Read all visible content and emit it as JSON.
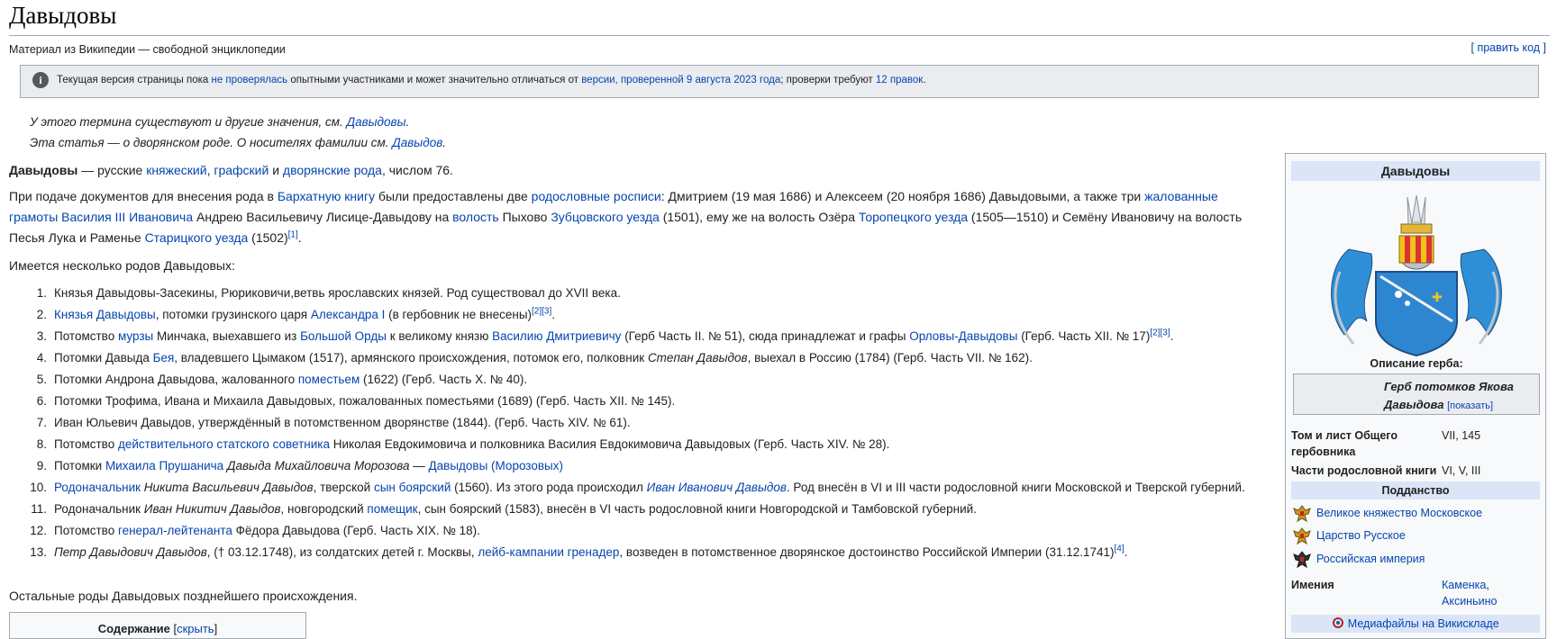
{
  "title": "Давыдовы",
  "tagline": "Материал из Википедии — свободной энциклопедии",
  "edit_link": "[ править код ]",
  "notice": {
    "t1": "Текущая версия страницы пока ",
    "l1": "не проверялась",
    "t2": " опытными участниками и может значительно отличаться от ",
    "l2": "версии, проверенной 9 августа 2023 года",
    "t3": "; проверки требуют ",
    "l3": "12 правок",
    "t4": "."
  },
  "hatnotes": {
    "h1_text": "У этого термина существуют и другие значения, см. ",
    "h1_link": "Давыдовы",
    "h1_end": ".",
    "h2_text": "Эта статья — о дворянском роде. О носителях фамилии см. ",
    "h2_link": "Давыдов",
    "h2_end": "."
  },
  "intro": {
    "bold": "Давыдовы",
    "t1": " — русские ",
    "l1": "княжеский",
    "t2": ", ",
    "l2": "графский",
    "t3": " и ",
    "l3": "дворянские рода",
    "t4": ", числом 76."
  },
  "para2": {
    "t1": "При подаче документов для внесения рода в ",
    "l1": "Бархатную книгу",
    "t2": " были предоставлены две ",
    "l2": "родословные росписи",
    "t3": ": Дмитрием (19 мая 1686) и Алексеем (20 ноября 1686) Давыдовыми, а также три ",
    "l3": "жалованные грамоты",
    "t4": " ",
    "l4": "Василия III Ивановича",
    "t5": " Андрею Васильевичу Лисице-Давыдову на ",
    "l5": "волость",
    "t6": " Пыхово ",
    "l6": "Зубцовского уезда",
    "t7": " (1501), ему же на волость Озёра ",
    "l7": "Торопецкого уезда",
    "t8": " (1505—1510) и Семёну Ивановичу на волость Песья Лука и Раменье ",
    "l8": "Старицкого уезда",
    "t9": " (1502)",
    "s1": "[1]",
    "t10": "."
  },
  "para3": "Имеется несколько родов Давыдовых:",
  "list": [
    {
      "n": "1.",
      "parts": [
        {
          "t": "Князья Давыдовы-Засекины, Рюриковичи,ветвь ярославских князей. Род существовал до XVII века."
        }
      ]
    },
    {
      "n": "2.",
      "parts": [
        {
          "l": "Князья Давыдовы"
        },
        {
          "t": ", потомки грузинского царя "
        },
        {
          "l": "Александра I"
        },
        {
          "t": " (в гербовник не внесены)"
        },
        {
          "s": "[2][3]"
        },
        {
          "t": "."
        }
      ]
    },
    {
      "n": "3.",
      "parts": [
        {
          "t": "Потомство "
        },
        {
          "l": "мурзы"
        },
        {
          "t": " Минчака, выехавшего из "
        },
        {
          "l": "Большой Орды"
        },
        {
          "t": " к великому князю "
        },
        {
          "l": "Василию Дмитриевичу"
        },
        {
          "t": " (Герб Часть II. № 51), сюда принадлежат и графы "
        },
        {
          "l": "Орловы-Давыдовы"
        },
        {
          "t": " (Герб. Часть XII. № 17)"
        },
        {
          "s": "[2][3]"
        },
        {
          "t": "."
        }
      ]
    },
    {
      "n": "4.",
      "parts": [
        {
          "t": "Потомки Давыда "
        },
        {
          "l": "Бея"
        },
        {
          "t": ", владевшего Цымаком (1517), армянского происхождения, потомок его, полковник "
        },
        {
          "i": "Степан Давыдов"
        },
        {
          "t": ", выехал в Россию (1784) (Герб. Часть VII. № 162)."
        }
      ]
    },
    {
      "n": "5.",
      "parts": [
        {
          "t": "Потомки Андрона Давыдова, жалованного "
        },
        {
          "l": "поместьем"
        },
        {
          "t": " (1622) (Герб. Часть X. № 40)."
        }
      ]
    },
    {
      "n": "6.",
      "parts": [
        {
          "t": "Потомки Трофима, Ивана и Михаила Давыдовых, пожалованных поместьями (1689) (Герб. Часть XII. № 145)."
        }
      ]
    },
    {
      "n": "7.",
      "parts": [
        {
          "t": "Иван Юльевич Давыдов, утверждённый в потомственном дворянстве (1844). (Герб. Часть XIV. № 61)."
        }
      ]
    },
    {
      "n": "8.",
      "parts": [
        {
          "t": "Потомство "
        },
        {
          "l": "действительного статского советника"
        },
        {
          "t": " Николая Евдокимовича и полковника Василия Евдокимовича Давыдовых (Герб. Часть XIV. № 28)."
        }
      ]
    },
    {
      "n": "9.",
      "parts": [
        {
          "t": "Потомки "
        },
        {
          "l": "Михаила Прушанича"
        },
        {
          "t": " "
        },
        {
          "i": "Давыда Михайловича Морозова"
        },
        {
          "t": " — "
        },
        {
          "l": "Давыдовы (Морозовых)"
        }
      ]
    },
    {
      "n": "10.",
      "parts": [
        {
          "l": "Родоначальник"
        },
        {
          "t": " "
        },
        {
          "i": "Никита Васильевич Давыдов"
        },
        {
          "t": ", тверской "
        },
        {
          "l": "сын боярский"
        },
        {
          "t": " (1560). Из этого рода происходил "
        },
        {
          "li": "Иван Иванович Давыдов"
        },
        {
          "t": ". Род внесён в VI и III части родословной книги Московской и Тверской губерний."
        }
      ]
    },
    {
      "n": "11.",
      "parts": [
        {
          "t": "Родоначальник "
        },
        {
          "i": "Иван Никитич Давыдов"
        },
        {
          "t": ", новгородский "
        },
        {
          "l": "помещик"
        },
        {
          "t": ", сын боярский (1583), внесён в VI часть родословной книги Новгородской и Тамбовской губерний."
        }
      ]
    },
    {
      "n": "12.",
      "parts": [
        {
          "t": "Потомство "
        },
        {
          "l": "генерал-лейтенанта"
        },
        {
          "t": " Фёдора Давыдова (Герб. Часть XIX. № 18)."
        }
      ]
    },
    {
      "n": "13.",
      "parts": [
        {
          "i": "Петр Давыдович Давыдов"
        },
        {
          "t": ", († 03.12.1748), из солдатских детей г. Москвы, "
        },
        {
          "l": "лейб-кампании гренадер"
        },
        {
          "t": ", возведен в потомственное дворянское достоинство Российской Империи (31.12.1741)"
        },
        {
          "s": "[4]"
        },
        {
          "t": "."
        }
      ]
    }
  ],
  "para_after": "Остальные роды Давыдовых позднейшего происхождения.",
  "toc": {
    "title": "Содержание",
    "toggle": "скрыть"
  },
  "infobox": {
    "title": "Давыдовы",
    "coat_label": "Описание герба:",
    "coat_caption": "Герб потомков Якова Давыдова",
    "coat_show": "[показать]",
    "rows": [
      {
        "label": "Том и лист Общего гербовника",
        "value": "VII, 145"
      },
      {
        "label": "Части родословной книги",
        "value": "VI, V, III"
      }
    ],
    "subjects_header": "Подданство",
    "realms": [
      "Великое княжество Московское",
      "Царство Русское",
      "Российская империя"
    ],
    "estates_label": "Имения",
    "estates": [
      "Каменка",
      "Аксиньино"
    ],
    "media": "Медиафайлы на Викискладе"
  },
  "colors": {
    "link": "#0645ad",
    "band": "#dbe5f8",
    "border": "#a2a9b1"
  }
}
